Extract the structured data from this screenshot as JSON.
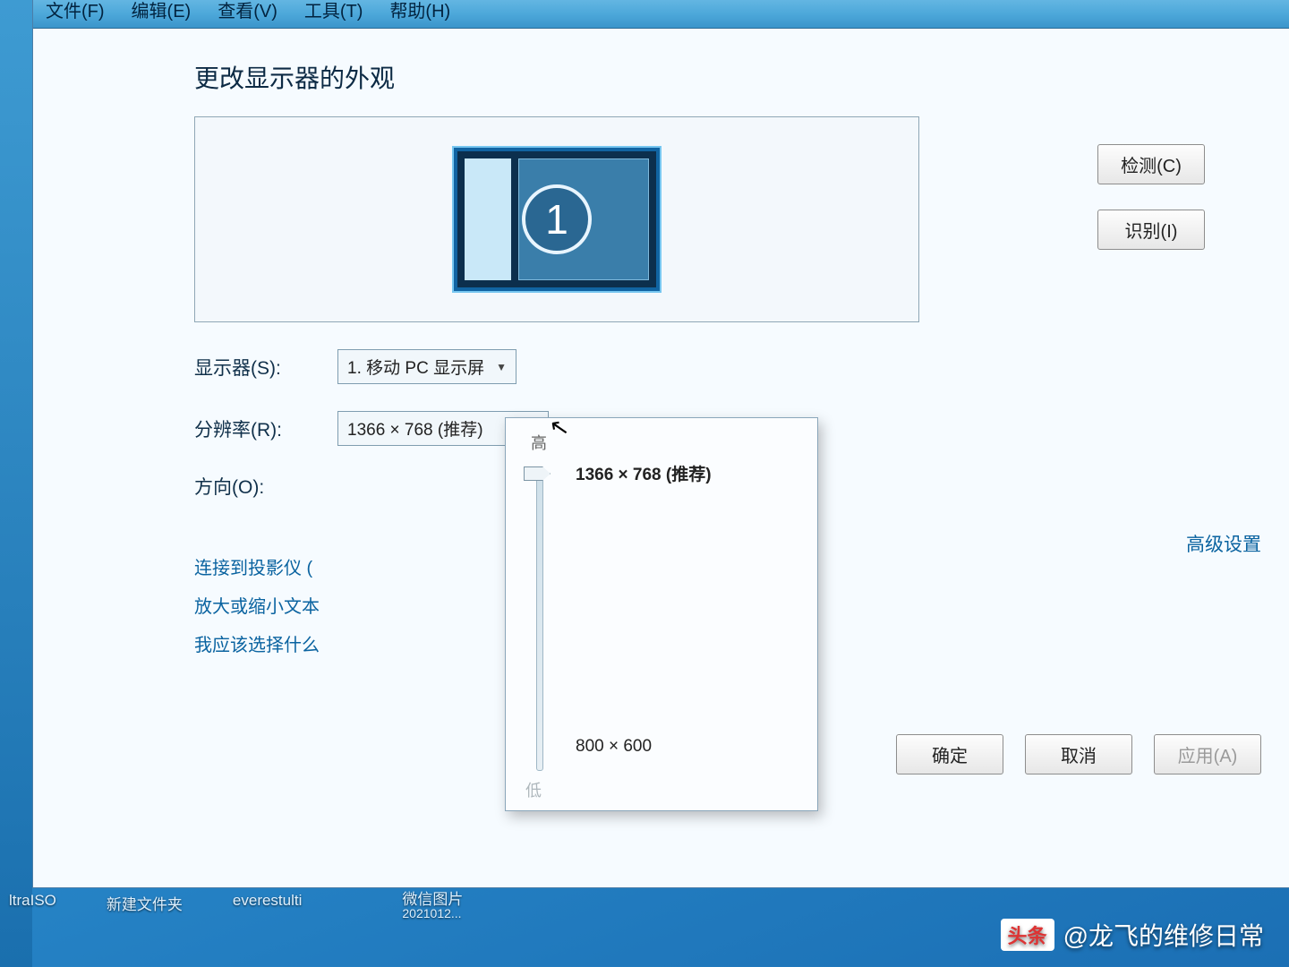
{
  "menubar": {
    "file": "文件(F)",
    "edit": "编辑(E)",
    "view": "查看(V)",
    "tools": "工具(T)",
    "help": "帮助(H)"
  },
  "page": {
    "title": "更改显示器的外观"
  },
  "buttons": {
    "detect": "检测(C)",
    "identify": "识别(I)",
    "ok": "确定",
    "cancel": "取消",
    "apply": "应用(A)"
  },
  "monitor": {
    "number": "1"
  },
  "labels": {
    "display": "显示器(S):",
    "resolution": "分辨率(R):",
    "orientation": "方向(O):"
  },
  "combos": {
    "display": "1. 移动 PC 显示屏",
    "resolution": "1366 × 768 (推荐)"
  },
  "popup": {
    "high": "高",
    "low": "低",
    "current": "1366 × 768 (推荐)",
    "alt": "800 × 600"
  },
  "links": {
    "projector": "连接到投影仪 (",
    "textsize": "放大或缩小文本",
    "which": "我应该选择什么",
    "advanced": "高级设置"
  },
  "desktop": {
    "i1": "ltraISO",
    "i2": "新建文件夹",
    "i3": "everestulti",
    "i5": "微信图片",
    "i5b": "2021012..."
  },
  "watermark": {
    "brand": "头条",
    "user": "@龙飞的维修日常"
  }
}
